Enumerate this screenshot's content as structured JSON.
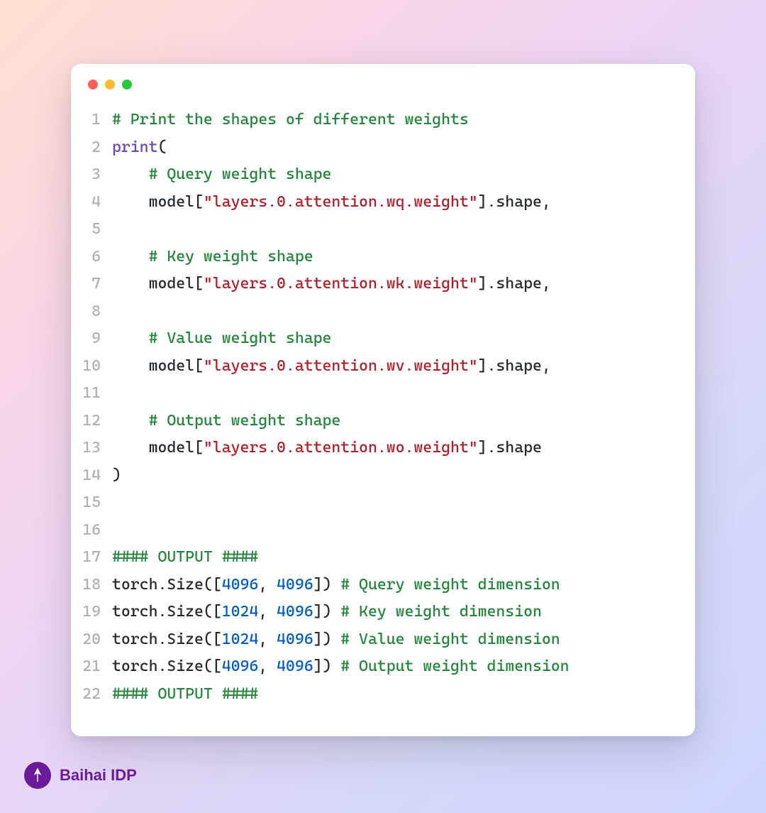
{
  "brand": {
    "name": "Baihai IDP"
  },
  "code": {
    "lines": [
      {
        "n": 1,
        "tokens": [
          {
            "t": "# Print the shapes of different weights",
            "c": "comment"
          }
        ]
      },
      {
        "n": 2,
        "tokens": [
          {
            "t": "print",
            "c": "func"
          },
          {
            "t": "(",
            "c": "punct"
          }
        ]
      },
      {
        "n": 3,
        "tokens": [
          {
            "t": "    ",
            "c": "default"
          },
          {
            "t": "# Query weight shape",
            "c": "comment"
          }
        ]
      },
      {
        "n": 4,
        "tokens": [
          {
            "t": "    model[",
            "c": "default"
          },
          {
            "t": "\"layers.0.attention.wq.weight\"",
            "c": "string"
          },
          {
            "t": "].shape,",
            "c": "default"
          }
        ]
      },
      {
        "n": 5,
        "tokens": [
          {
            "t": "",
            "c": "default"
          }
        ]
      },
      {
        "n": 6,
        "tokens": [
          {
            "t": "    ",
            "c": "default"
          },
          {
            "t": "# Key weight shape",
            "c": "comment"
          }
        ]
      },
      {
        "n": 7,
        "tokens": [
          {
            "t": "    model[",
            "c": "default"
          },
          {
            "t": "\"layers.0.attention.wk.weight\"",
            "c": "string"
          },
          {
            "t": "].shape,",
            "c": "default"
          }
        ]
      },
      {
        "n": 8,
        "tokens": [
          {
            "t": "",
            "c": "default"
          }
        ]
      },
      {
        "n": 9,
        "tokens": [
          {
            "t": "    ",
            "c": "default"
          },
          {
            "t": "# Value weight shape",
            "c": "comment"
          }
        ]
      },
      {
        "n": 10,
        "tokens": [
          {
            "t": "    model[",
            "c": "default"
          },
          {
            "t": "\"layers.0.attention.wv.weight\"",
            "c": "string"
          },
          {
            "t": "].shape,",
            "c": "default"
          }
        ]
      },
      {
        "n": 11,
        "tokens": [
          {
            "t": "",
            "c": "default"
          }
        ]
      },
      {
        "n": 12,
        "tokens": [
          {
            "t": "    ",
            "c": "default"
          },
          {
            "t": "# Output weight shape",
            "c": "comment"
          }
        ]
      },
      {
        "n": 13,
        "tokens": [
          {
            "t": "    model[",
            "c": "default"
          },
          {
            "t": "\"layers.0.attention.wo.weight\"",
            "c": "string"
          },
          {
            "t": "].shape",
            "c": "default"
          }
        ]
      },
      {
        "n": 14,
        "tokens": [
          {
            "t": ")",
            "c": "punct"
          }
        ]
      },
      {
        "n": 15,
        "tokens": [
          {
            "t": "",
            "c": "default"
          }
        ]
      },
      {
        "n": 16,
        "tokens": [
          {
            "t": "",
            "c": "default"
          }
        ]
      },
      {
        "n": 17,
        "tokens": [
          {
            "t": "#### OUTPUT ####",
            "c": "comment"
          }
        ]
      },
      {
        "n": 18,
        "tokens": [
          {
            "t": "torch.Size([",
            "c": "default"
          },
          {
            "t": "4096",
            "c": "number"
          },
          {
            "t": ", ",
            "c": "default"
          },
          {
            "t": "4096",
            "c": "number"
          },
          {
            "t": "]) ",
            "c": "default"
          },
          {
            "t": "# Query weight dimension",
            "c": "comment"
          }
        ]
      },
      {
        "n": 19,
        "tokens": [
          {
            "t": "torch.Size([",
            "c": "default"
          },
          {
            "t": "1024",
            "c": "number"
          },
          {
            "t": ", ",
            "c": "default"
          },
          {
            "t": "4096",
            "c": "number"
          },
          {
            "t": "]) ",
            "c": "default"
          },
          {
            "t": "# Key weight dimension",
            "c": "comment"
          }
        ]
      },
      {
        "n": 20,
        "tokens": [
          {
            "t": "torch.Size([",
            "c": "default"
          },
          {
            "t": "1024",
            "c": "number"
          },
          {
            "t": ", ",
            "c": "default"
          },
          {
            "t": "4096",
            "c": "number"
          },
          {
            "t": "]) ",
            "c": "default"
          },
          {
            "t": "# Value weight dimension",
            "c": "comment"
          }
        ]
      },
      {
        "n": 21,
        "tokens": [
          {
            "t": "torch.Size([",
            "c": "default"
          },
          {
            "t": "4096",
            "c": "number"
          },
          {
            "t": ", ",
            "c": "default"
          },
          {
            "t": "4096",
            "c": "number"
          },
          {
            "t": "]) ",
            "c": "default"
          },
          {
            "t": "# Output weight dimension",
            "c": "comment"
          }
        ]
      },
      {
        "n": 22,
        "tokens": [
          {
            "t": "#### OUTPUT ####",
            "c": "comment"
          }
        ]
      }
    ]
  }
}
